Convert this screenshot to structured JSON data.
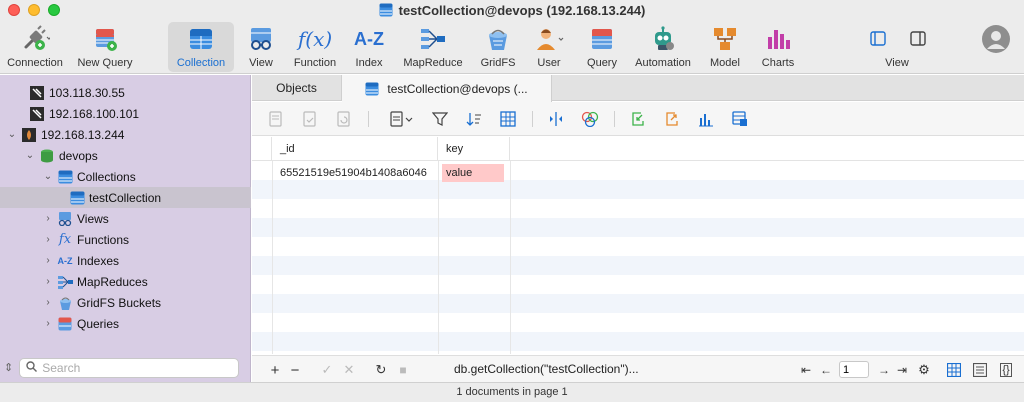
{
  "window": {
    "title": "testCollection@devops (192.168.13.244)",
    "traffic_lights": [
      "close",
      "minimize",
      "zoom"
    ]
  },
  "toolbar": {
    "connection": "Connection",
    "new_query": "New Query",
    "collection": "Collection",
    "view": "View",
    "function": "Function",
    "index": "Index",
    "mapreduce": "MapReduce",
    "gridfs": "GridFS",
    "user": "User",
    "query": "Query",
    "automation": "Automation",
    "model": "Model",
    "charts": "Charts",
    "view_toggle": "View",
    "index_glyph": "A-Z",
    "function_glyph": "f(x)"
  },
  "sidebar": {
    "connections": [
      {
        "label": "103.118.30.55"
      },
      {
        "label": "192.168.100.101"
      },
      {
        "label": "192.168.13.244"
      }
    ],
    "database": "devops",
    "groups": {
      "collections": "Collections",
      "test_collection": "testCollection",
      "views": "Views",
      "functions": "Functions",
      "indexes": "Indexes",
      "mapreduces": "MapReduces",
      "gridfs_buckets": "GridFS Buckets",
      "queries": "Queries"
    },
    "index_glyph": "A-Z",
    "search_placeholder": "Search"
  },
  "tabs": {
    "objects": "Objects",
    "collection": "testCollection@devops (..."
  },
  "grid": {
    "columns": [
      "_id",
      "key"
    ],
    "rows": [
      {
        "_id": "65521519e51904b1408a6046",
        "key": "value"
      }
    ]
  },
  "bottombar": {
    "query": "db.getCollection(\"testCollection\")...",
    "page": "1"
  },
  "status": {
    "text": "1 documents in page 1"
  },
  "colors": {
    "accent": "#1a6fd1",
    "sidebar_bg": "#d8cde4",
    "value_highlight": "#ffc9c9"
  }
}
